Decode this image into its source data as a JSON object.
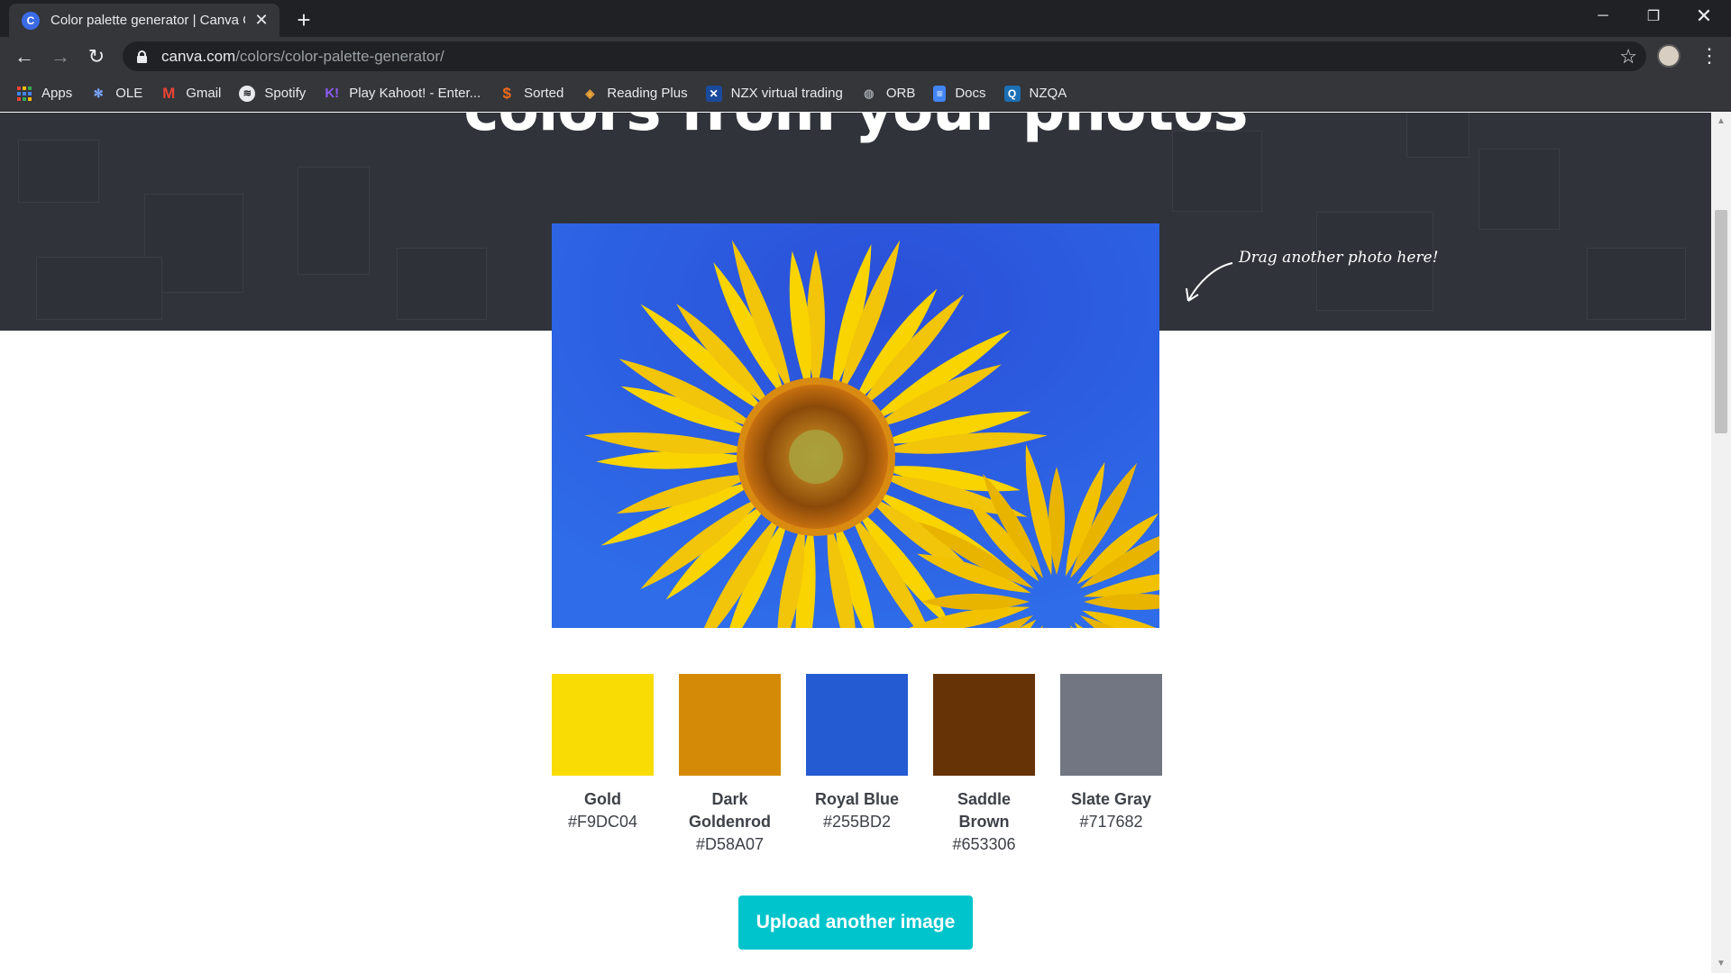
{
  "tab": {
    "title": "Color palette generator | Canva C",
    "favicon": "C"
  },
  "window_controls": {
    "minimize": "─",
    "maximize": "❐",
    "close": "✕"
  },
  "address_bar": {
    "host": "canva.com",
    "path": "/colors/color-palette-generator/"
  },
  "bookmarks": [
    {
      "label": "Apps",
      "icon": "apps-grid-icon"
    },
    {
      "label": "OLE",
      "icon": "ole-icon"
    },
    {
      "label": "Gmail",
      "icon": "gmail-icon"
    },
    {
      "label": "Spotify",
      "icon": "spotify-icon"
    },
    {
      "label": "Play Kahoot! - Enter...",
      "icon": "kahoot-icon"
    },
    {
      "label": "Sorted",
      "icon": "sorted-icon"
    },
    {
      "label": "Reading Plus",
      "icon": "reading-plus-icon"
    },
    {
      "label": "NZX virtual trading",
      "icon": "nzx-icon"
    },
    {
      "label": "ORB",
      "icon": "orb-icon"
    },
    {
      "label": "Docs",
      "icon": "docs-icon"
    },
    {
      "label": "NZQA",
      "icon": "nzqa-icon"
    }
  ],
  "hero": {
    "title": "colors from your photos",
    "drag_hint": "Drag another photo here!"
  },
  "photo": {
    "subject": "sunflower"
  },
  "palette": [
    {
      "name": "Gold",
      "hex": "#F9DC04"
    },
    {
      "name": "Dark Goldenrod",
      "hex": "#D58A07"
    },
    {
      "name": "Royal Blue",
      "hex": "#255BD2"
    },
    {
      "name": "Saddle Brown",
      "hex": "#653306"
    },
    {
      "name": "Slate Gray",
      "hex": "#717682"
    }
  ],
  "upload_button": "Upload another image",
  "colors": {
    "accent": "#00C4CC",
    "hero_bg": "#30333A",
    "chrome_dark": "#202124"
  }
}
